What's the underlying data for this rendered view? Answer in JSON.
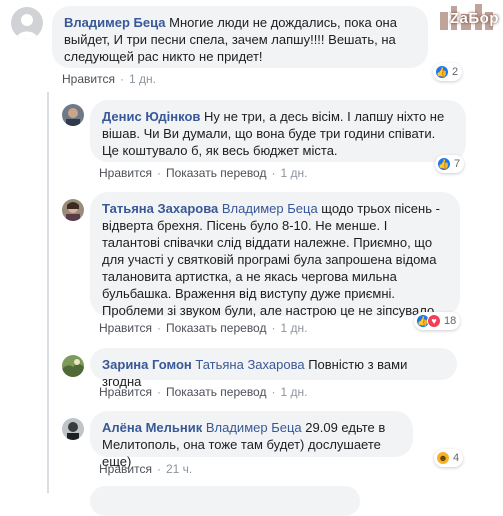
{
  "watermark": "ZаБор",
  "actions": {
    "like": "Нравится",
    "translate": "Показать перевод",
    "sep": "·"
  },
  "comments": [
    {
      "author": "Владимер Беца",
      "mention": "",
      "text": "Многие люди не дождались, пока она выйдет, И три песни спела, зачем лапшу!!!! Вешать, на следующей рас никто не придет!",
      "time": "1 дн.",
      "show_translate": false,
      "reactions": [
        "like"
      ],
      "reaction_count": "2"
    },
    {
      "author": "Денис Юдінков",
      "mention": "",
      "text": "Ну не три, а десь вісім. І лапшу ніхто не вішав. Чи Ви думали, що вона буде три години співати. Це коштувало б, як весь бюджет міста.",
      "time": "1 дн.",
      "show_translate": true,
      "reactions": [
        "like"
      ],
      "reaction_count": "7"
    },
    {
      "author": "Татьяна Захарова",
      "mention": "Владимер Беца",
      "text": "щодо трьох пісень - відверта брехня. Пісень було 8-10. Не менше. І талантові співачки слід віддати належне. Приємно, що для участі у святковій програмі була запрошена відома талановита артистка, а не якась чергова мильна бульбашка. Враження від виступу дуже приємні. Проблеми зі звуком були, але настрою це не зіпсувало.",
      "time": "1 дн.",
      "show_translate": true,
      "reactions": [
        "like",
        "love"
      ],
      "reaction_count": "18"
    },
    {
      "author": "Зарина Гомон",
      "mention": "Татьяна Захарова",
      "text": "Повністю з вами згодна",
      "time": "1 дн.",
      "show_translate": true,
      "reactions": [],
      "reaction_count": ""
    },
    {
      "author": "Алёна Мельник",
      "mention": "Владимер Беца",
      "text": "29.09 едьте в Мелитополь, она тоже там будет) дослушаете еще)",
      "time": "21 ч.",
      "show_translate": false,
      "reactions": [
        "haha"
      ],
      "reaction_count": "4"
    }
  ]
}
